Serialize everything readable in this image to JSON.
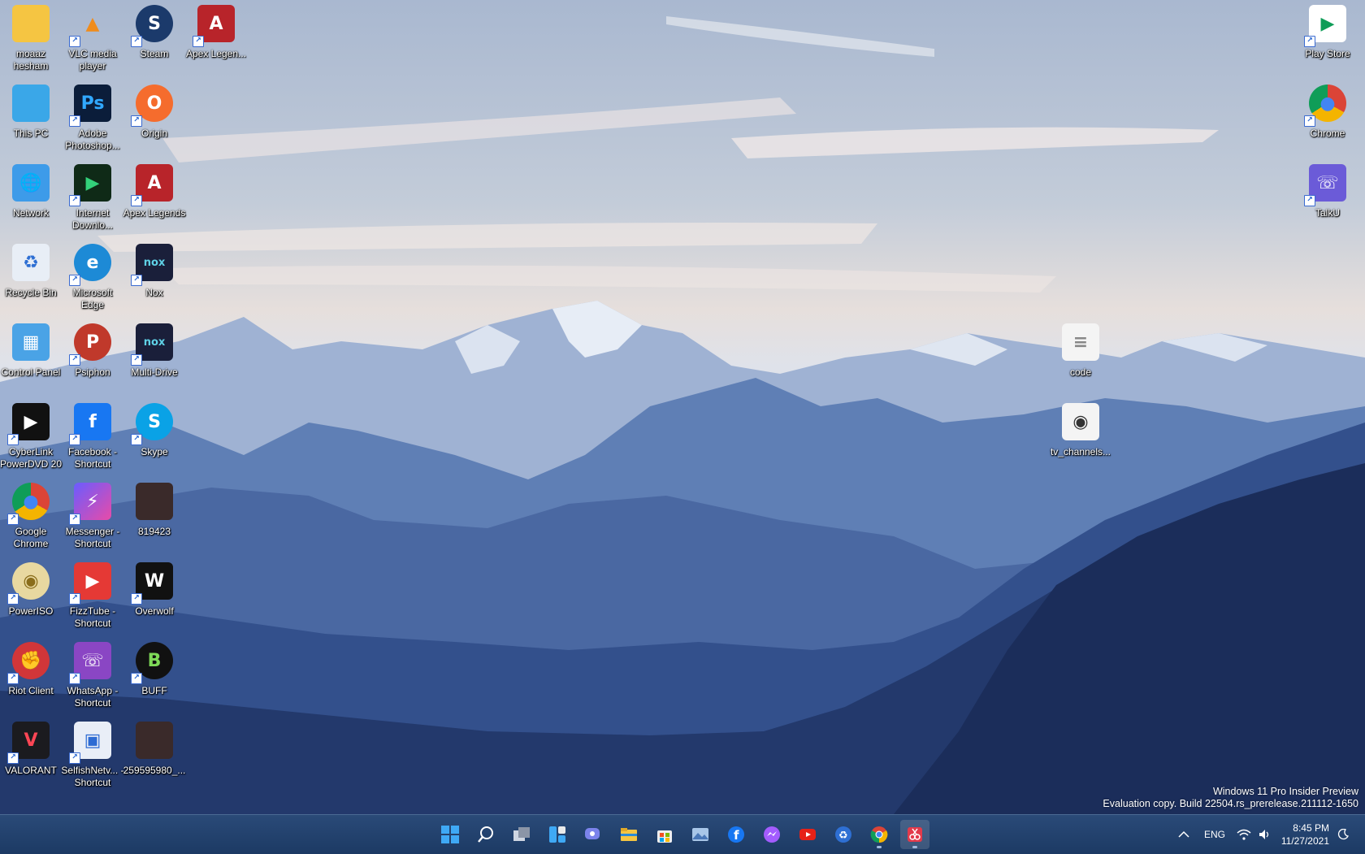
{
  "desktop": {
    "left_icons": [
      {
        "label": "moaaz hesham",
        "icon": "folder-icon"
      },
      {
        "label": "VLC media player",
        "icon": "vlc-icon"
      },
      {
        "label": "Steam",
        "icon": "steam-icon"
      },
      {
        "label": "Apex Legen...",
        "icon": "apex-icon"
      },
      {
        "label": "This PC",
        "icon": "monitor-icon"
      },
      {
        "label": "Adobe Photoshop...",
        "icon": "photoshop-icon"
      },
      {
        "label": "Origin",
        "icon": "origin-icon"
      },
      {
        "label": "Network",
        "icon": "network-icon"
      },
      {
        "label": "Internet Downlo...",
        "icon": "idm-icon"
      },
      {
        "label": "Apex Legends",
        "icon": "apex-icon"
      },
      {
        "label": "Recycle Bin",
        "icon": "recycle-bin-icon"
      },
      {
        "label": "Microsoft Edge",
        "icon": "edge-icon"
      },
      {
        "label": "Nox",
        "icon": "nox-icon"
      },
      {
        "label": "Control Panel",
        "icon": "control-panel-icon"
      },
      {
        "label": "Psiphon",
        "icon": "psiphon-icon"
      },
      {
        "label": "Multi-Drive",
        "icon": "nox-icon"
      },
      {
        "label": "CyberLink PowerDVD 20",
        "icon": "powerdvd-icon"
      },
      {
        "label": "Facebook - Shortcut",
        "icon": "facebook-icon"
      },
      {
        "label": "Skype",
        "icon": "skype-icon"
      },
      {
        "label": "Google Chrome",
        "icon": "chrome-icon"
      },
      {
        "label": "Messenger - Shortcut",
        "icon": "messenger-icon"
      },
      {
        "label": "819423",
        "icon": "image-thumbnail-icon"
      },
      {
        "label": "PowerISO",
        "icon": "poweriso-icon"
      },
      {
        "label": "FizzTube - Shortcut",
        "icon": "fizztube-icon"
      },
      {
        "label": "Overwolf",
        "icon": "overwolf-icon"
      },
      {
        "label": "Riot Client",
        "icon": "riot-icon"
      },
      {
        "label": "WhatsApp - Shortcut",
        "icon": "whatsapp-icon"
      },
      {
        "label": "BUFF",
        "icon": "buff-icon"
      },
      {
        "label": "VALORANT",
        "icon": "valorant-icon"
      },
      {
        "label": "SelfishNetv... - Shortcut",
        "icon": "selfishnet-icon"
      },
      {
        "label": "259595980_...",
        "icon": "image-thumbnail-icon"
      }
    ],
    "right_icons": [
      {
        "label": "Play Store",
        "icon": "play-store-icon"
      },
      {
        "label": "Chrome",
        "icon": "chrome-icon"
      },
      {
        "label": "TalkU",
        "icon": "talku-icon"
      },
      {
        "label": "code",
        "icon": "text-file-icon"
      },
      {
        "label": "tv_channels...",
        "icon": "media-file-icon"
      }
    ]
  },
  "watermark": {
    "line1": "Windows 11 Pro Insider Preview",
    "line2": "Evaluation copy. Build 22504.rs_prerelease.211112-1650"
  },
  "taskbar": {
    "apps": [
      "start",
      "search",
      "task-view",
      "widgets",
      "chat",
      "file-explorer",
      "store",
      "photos",
      "facebook",
      "messenger",
      "youtube",
      "recycle",
      "chrome",
      "snipping-tool"
    ],
    "language": "ENG",
    "time": "8:45 PM",
    "date": "11/27/2021"
  },
  "colors": {
    "sky_top": "#a9bad2",
    "mountain_mid": "#4f6fa8",
    "mountain_dark": "#1e3566",
    "taskbar": "#1f3f6a"
  }
}
